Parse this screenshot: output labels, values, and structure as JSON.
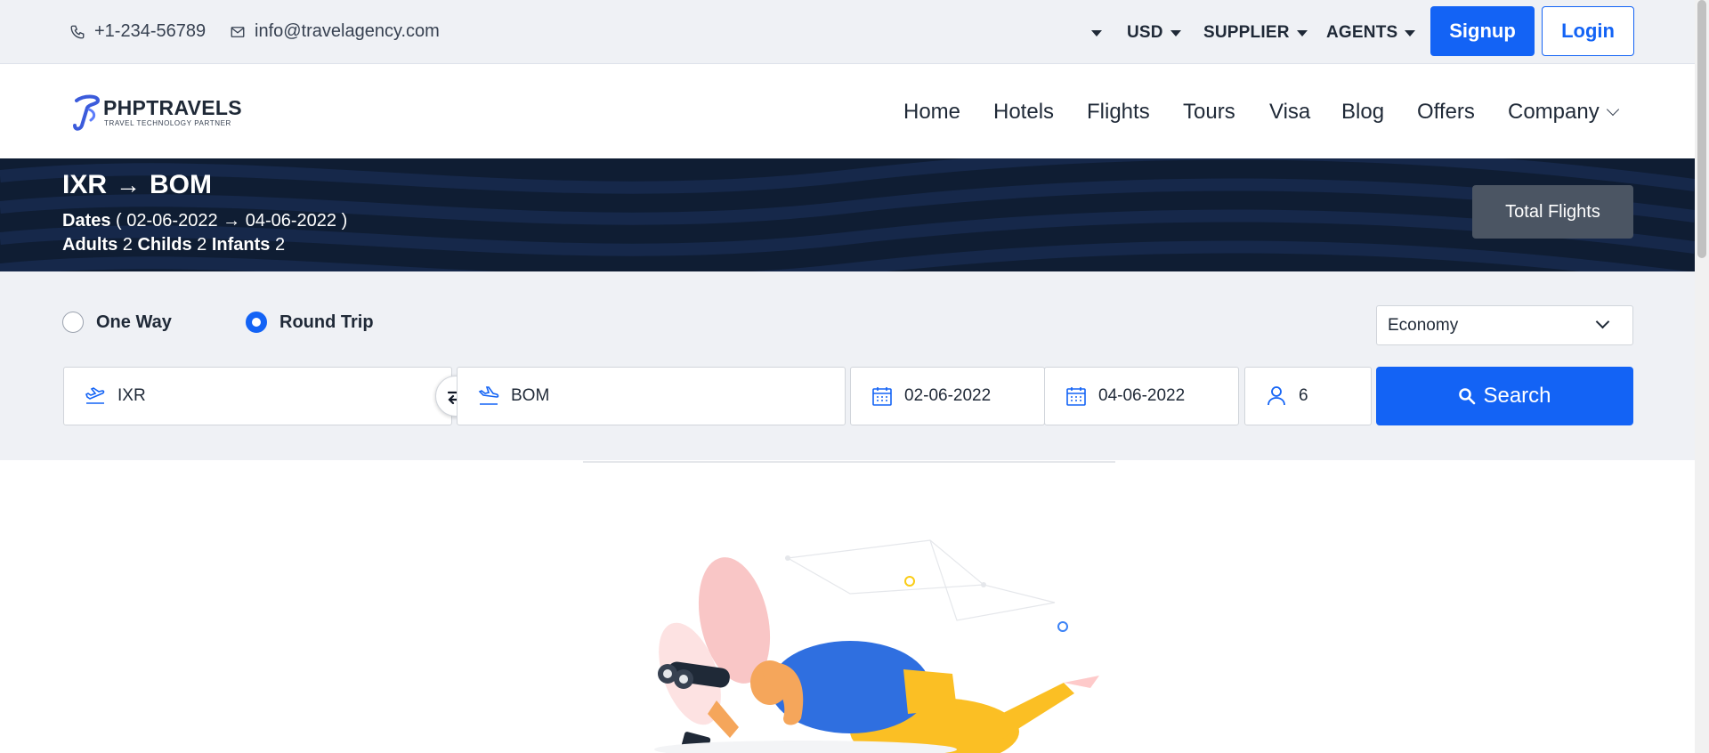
{
  "topbar": {
    "phone": "+1-234-56789",
    "email": "info@travelagency.com",
    "currency": "USD",
    "supplier": "SUPPLIER",
    "agents": "AGENTS",
    "signup": "Signup",
    "login": "Login"
  },
  "navbar": {
    "logo_name": "PHPTRAVELS",
    "logo_tagline": "TRAVEL TECHNOLOGY PARTNER",
    "items": [
      "Home",
      "Hotels",
      "Flights",
      "Tours",
      "Visa",
      "Blog",
      "Offers",
      "Company"
    ]
  },
  "hero": {
    "origin": "IXR",
    "destination": "BOM",
    "dates_label": "Dates",
    "depart_date": "02-06-2022",
    "return_date": "04-06-2022",
    "adults_label": "Adults",
    "adults": "2",
    "childs_label": "Childs",
    "childs": "2",
    "infants_label": "Infants",
    "infants": "2",
    "total_flights": "Total Flights"
  },
  "search": {
    "trip_types": [
      "One Way",
      "Round Trip"
    ],
    "selected_trip": "Round Trip",
    "cabin_class": "Economy",
    "from": "IXR",
    "to": "BOM",
    "depart": "02-06-2022",
    "return": "04-06-2022",
    "travellers": "6",
    "search_button": "Search"
  },
  "colors": {
    "primary": "#1363f5",
    "hero_bg": "#0f1d33",
    "topbar_bg": "#eff1f5"
  }
}
